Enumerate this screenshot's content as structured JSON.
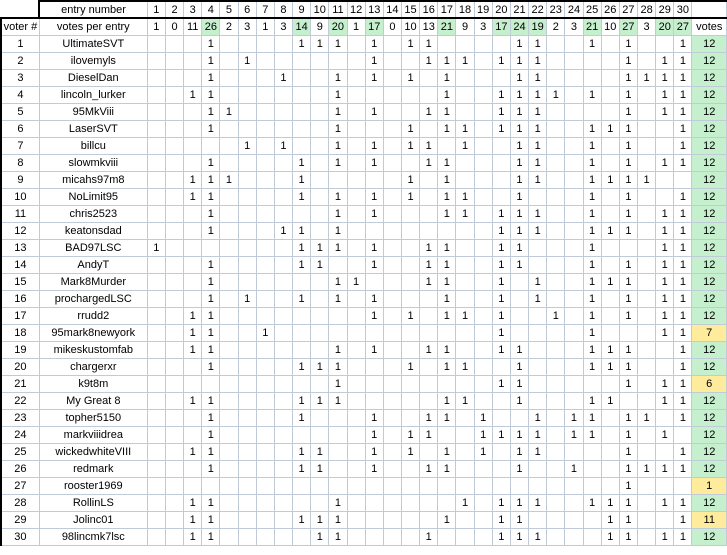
{
  "header": {
    "entry_number_label": "entry number",
    "votes_per_entry_label": "votes per entry",
    "voter_label": "voter #",
    "votes_label": "votes",
    "entry_numbers": [
      1,
      2,
      3,
      4,
      5,
      6,
      7,
      8,
      9,
      10,
      11,
      12,
      13,
      14,
      15,
      16,
      17,
      18,
      19,
      20,
      21,
      22,
      23,
      24,
      25,
      26,
      27,
      28,
      29,
      30
    ],
    "votes_per_entry": [
      1,
      0,
      11,
      26,
      2,
      3,
      1,
      3,
      14,
      9,
      20,
      1,
      17,
      0,
      10,
      13,
      21,
      9,
      3,
      17,
      24,
      19,
      2,
      3,
      21,
      10,
      27,
      3,
      20,
      27
    ],
    "highlight_color": "#c6efce",
    "highlight_text_color": "#1d6f42",
    "warn_color": "#ffeb9c",
    "warn_text_color": "#9c6500",
    "highlighted_entries": [
      4,
      9,
      11,
      13,
      17,
      20,
      21,
      22,
      25,
      27,
      29,
      30
    ]
  },
  "mark": "1",
  "rows": [
    {
      "voter": 1,
      "name": "UltimateSVT",
      "picks": [
        4,
        9,
        10,
        11,
        13,
        15,
        16,
        21,
        22,
        25,
        27,
        30
      ],
      "votes": 12,
      "status": "ok"
    },
    {
      "voter": 2,
      "name": "ilovemyls",
      "picks": [
        4,
        6,
        13,
        16,
        17,
        18,
        20,
        21,
        22,
        27,
        29,
        30
      ],
      "votes": 12,
      "status": "ok"
    },
    {
      "voter": 3,
      "name": "DieselDan",
      "picks": [
        4,
        8,
        11,
        13,
        15,
        17,
        21,
        22,
        27,
        28,
        29,
        30
      ],
      "votes": 12,
      "status": "ok"
    },
    {
      "voter": 4,
      "name": "lincoln_lurker",
      "picks": [
        3,
        4,
        11,
        17,
        20,
        21,
        22,
        23,
        25,
        27,
        29,
        30
      ],
      "votes": 12,
      "status": "ok"
    },
    {
      "voter": 5,
      "name": "95MkViii",
      "picks": [
        4,
        5,
        11,
        13,
        16,
        17,
        20,
        21,
        22,
        27,
        29,
        30
      ],
      "votes": 12,
      "status": "ok"
    },
    {
      "voter": 6,
      "name": "LaserSVT",
      "picks": [
        4,
        11,
        15,
        17,
        18,
        20,
        21,
        22,
        25,
        26,
        27,
        30
      ],
      "votes": 12,
      "status": "ok"
    },
    {
      "voter": 7,
      "name": "billcu",
      "picks": [
        6,
        8,
        11,
        13,
        15,
        16,
        18,
        21,
        22,
        25,
        27,
        30
      ],
      "votes": 12,
      "status": "ok"
    },
    {
      "voter": 8,
      "name": "slowmkviii",
      "picks": [
        4,
        9,
        11,
        13,
        16,
        17,
        21,
        22,
        25,
        27,
        29,
        30
      ],
      "votes": 12,
      "status": "ok"
    },
    {
      "voter": 9,
      "name": "micahs97m8",
      "picks": [
        3,
        4,
        5,
        9,
        15,
        17,
        21,
        22,
        25,
        26,
        27,
        28
      ],
      "votes": 12,
      "status": "ok"
    },
    {
      "voter": 10,
      "name": "NoLimit95",
      "picks": [
        3,
        4,
        9,
        11,
        13,
        15,
        17,
        18,
        21,
        25,
        27,
        30
      ],
      "votes": 12,
      "status": "ok"
    },
    {
      "voter": 11,
      "name": "chris2523",
      "picks": [
        4,
        11,
        13,
        17,
        18,
        20,
        21,
        22,
        25,
        27,
        29,
        30
      ],
      "votes": 12,
      "status": "ok"
    },
    {
      "voter": 12,
      "name": "keatonsdad",
      "picks": [
        4,
        8,
        9,
        11,
        20,
        21,
        22,
        25,
        26,
        27,
        29,
        30
      ],
      "votes": 12,
      "status": "ok"
    },
    {
      "voter": 13,
      "name": "BAD97LSC",
      "picks": [
        1,
        9,
        10,
        11,
        13,
        16,
        17,
        20,
        21,
        25,
        29,
        30
      ],
      "votes": 12,
      "status": "ok"
    },
    {
      "voter": 14,
      "name": "AndyT",
      "picks": [
        4,
        9,
        10,
        13,
        16,
        17,
        20,
        21,
        25,
        27,
        29,
        30
      ],
      "votes": 12,
      "status": "ok"
    },
    {
      "voter": 15,
      "name": "Mark8Murder",
      "picks": [
        4,
        11,
        12,
        16,
        17,
        20,
        22,
        25,
        26,
        27,
        29,
        30
      ],
      "votes": 12,
      "status": "ok"
    },
    {
      "voter": 16,
      "name": "prochargedLSC",
      "picks": [
        4,
        6,
        9,
        11,
        13,
        17,
        20,
        22,
        25,
        27,
        29,
        30
      ],
      "votes": 12,
      "status": "ok"
    },
    {
      "voter": 17,
      "name": "rrudd2",
      "picks": [
        3,
        4,
        13,
        15,
        17,
        18,
        20,
        23,
        25,
        27,
        29,
        30
      ],
      "votes": 12,
      "status": "ok"
    },
    {
      "voter": 18,
      "name": "95mark8newyork",
      "picks": [
        3,
        4,
        7,
        20,
        25,
        29,
        30
      ],
      "votes": 7,
      "status": "warn"
    },
    {
      "voter": 19,
      "name": "mikeskustomfab",
      "picks": [
        3,
        4,
        11,
        13,
        16,
        17,
        20,
        21,
        25,
        26,
        27,
        30
      ],
      "votes": 12,
      "status": "ok"
    },
    {
      "voter": 20,
      "name": "chargerxr",
      "picks": [
        4,
        9,
        10,
        11,
        15,
        17,
        18,
        21,
        25,
        26,
        27,
        30
      ],
      "votes": 12,
      "status": "ok"
    },
    {
      "voter": 21,
      "name": "k9t8m",
      "picks": [
        11,
        20,
        21,
        27,
        29,
        30
      ],
      "votes": 6,
      "status": "warn"
    },
    {
      "voter": 22,
      "name": "My Great 8",
      "picks": [
        3,
        4,
        9,
        10,
        11,
        17,
        18,
        21,
        25,
        26,
        29,
        30
      ],
      "votes": 12,
      "status": "ok"
    },
    {
      "voter": 23,
      "name": "topher5150",
      "picks": [
        4,
        9,
        13,
        16,
        17,
        19,
        22,
        24,
        25,
        27,
        28,
        30
      ],
      "votes": 12,
      "status": "ok"
    },
    {
      "voter": 24,
      "name": "markviiidrea",
      "picks": [
        4,
        13,
        15,
        16,
        19,
        20,
        21,
        22,
        24,
        25,
        27,
        29
      ],
      "votes": 12,
      "status": "ok"
    },
    {
      "voter": 25,
      "name": "wickedwhiteVIII",
      "picks": [
        3,
        4,
        9,
        10,
        13,
        15,
        17,
        19,
        21,
        22,
        27,
        30
      ],
      "votes": 12,
      "status": "ok"
    },
    {
      "voter": 26,
      "name": "redmark",
      "picks": [
        4,
        9,
        10,
        13,
        16,
        17,
        21,
        24,
        27,
        28,
        29,
        30
      ],
      "votes": 12,
      "status": "ok"
    },
    {
      "voter": 27,
      "name": "rooster1969",
      "picks": [
        27
      ],
      "votes": 1,
      "status": "warn"
    },
    {
      "voter": 28,
      "name": "RollinLS",
      "picks": [
        3,
        4,
        11,
        18,
        20,
        21,
        22,
        25,
        26,
        27,
        29,
        30
      ],
      "votes": 12,
      "status": "ok"
    },
    {
      "voter": 29,
      "name": "Jolinc01",
      "picks": [
        3,
        4,
        9,
        10,
        11,
        17,
        20,
        21,
        26,
        27,
        30
      ],
      "votes": 11,
      "status": "warn"
    },
    {
      "voter": 30,
      "name": "98lincmk7lsc",
      "picks": [
        3,
        4,
        10,
        11,
        16,
        20,
        21,
        22,
        26,
        27,
        29,
        30
      ],
      "votes": 12,
      "status": "ok"
    }
  ]
}
